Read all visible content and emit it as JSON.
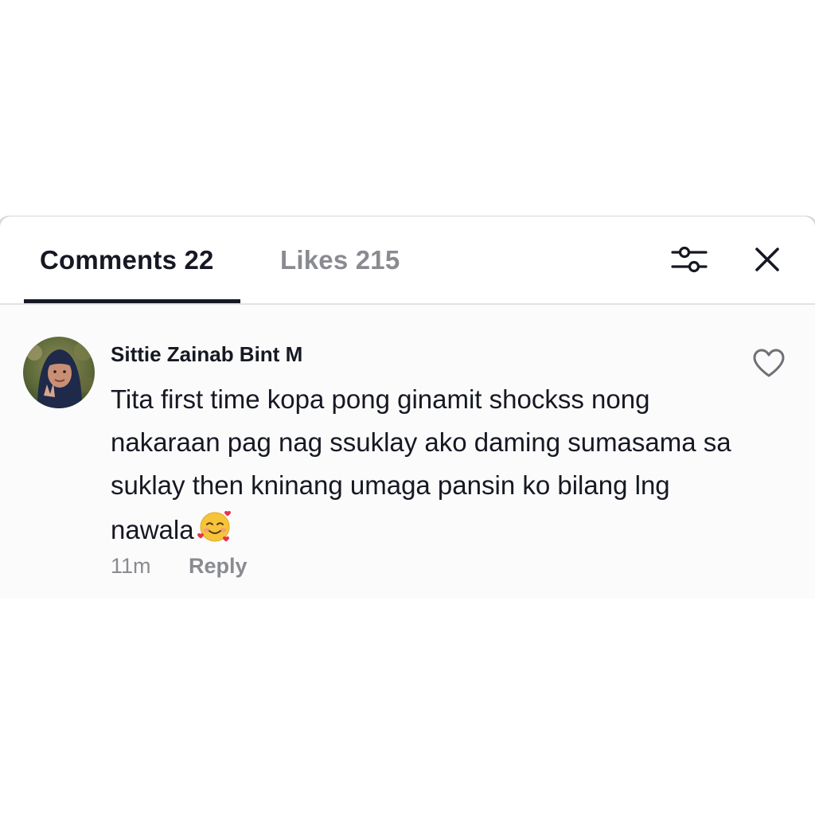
{
  "tabs": [
    {
      "label": "Comments 22",
      "active": true
    },
    {
      "label": "Likes 215",
      "active": false
    }
  ],
  "header_icons": {
    "filter": "sliders-icon",
    "close": "close-icon"
  },
  "comment": {
    "username": "Sittie Zainab Bint M",
    "text": "Tita first time kopa pong ginamit shockss nong nakaraan pag nag ssuklay ako daming sumasama sa suklay then kninang umaga pansin ko bilang lng nawala",
    "emoji": "smiling-face-with-hearts",
    "timestamp": "11m",
    "reply_label": "Reply",
    "like_icon": "heart-outline-icon"
  },
  "colors": {
    "text_primary": "#161823",
    "text_secondary": "#8a8b91",
    "divider": "#e2e2e2",
    "comment_bg": "#fbfbfb"
  }
}
